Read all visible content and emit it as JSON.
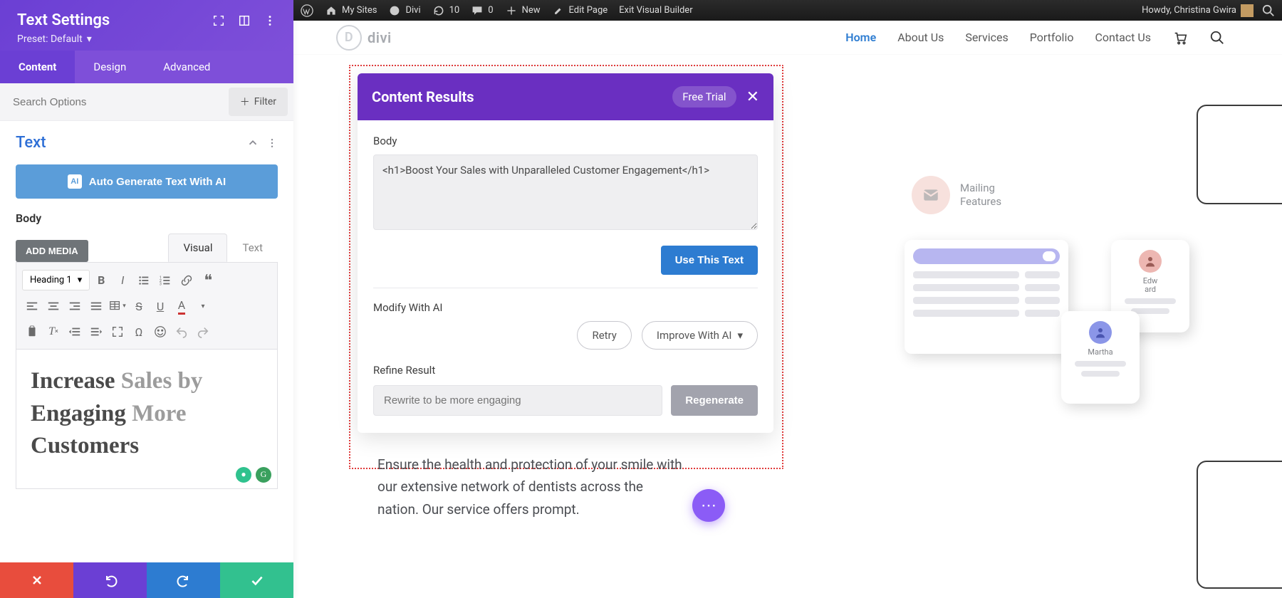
{
  "adminBar": {
    "mySites": "My Sites",
    "divi": "Divi",
    "refreshCount": "10",
    "commentsCount": "0",
    "new": "New",
    "editPage": "Edit Page",
    "exitVB": "Exit Visual Builder",
    "howdy": "Howdy, Christina Gwira"
  },
  "panel": {
    "title": "Text Settings",
    "preset": "Preset: Default",
    "tabs": {
      "content": "Content",
      "design": "Design",
      "advanced": "Advanced"
    },
    "searchPlaceholder": "Search Options",
    "filter": "Filter",
    "sectionTitle": "Text",
    "autoGen": "Auto Generate Text With AI",
    "bodyLabel": "Body",
    "addMedia": "ADD MEDIA",
    "editorTabs": {
      "visual": "Visual",
      "text": "Text"
    },
    "headingSelect": "Heading 1",
    "rte": {
      "p1a": "Increase ",
      "p1b": "Sales by",
      "p2a": "Engaging ",
      "p2b": "More",
      "p3a": "Customers"
    }
  },
  "site": {
    "brand": "divi",
    "nav": {
      "home": "Home",
      "about": "About Us",
      "services": "Services",
      "portfolio": "Portfolio",
      "contact": "Contact Us"
    }
  },
  "hero": {
    "mailing1": "Mailing",
    "mailing2": "Features",
    "personA": "Edw\nard",
    "personB": "Martha",
    "bodyText": "Ensure the health and protection of your smile with our extensive network of dentists across the nation. Our service offers prompt."
  },
  "modal": {
    "title": "Content Results",
    "freeTrial": "Free Trial",
    "bodyLabel": "Body",
    "bodyContent": "<h1>Boost Your Sales with Unparalleled Customer Engagement</h1>",
    "useText": "Use This Text",
    "modifyLabel": "Modify With AI",
    "retry": "Retry",
    "improve": "Improve With AI",
    "refineLabel": "Refine Result",
    "refinePlaceholder": "Rewrite to be more engaging",
    "regenerate": "Regenerate"
  }
}
